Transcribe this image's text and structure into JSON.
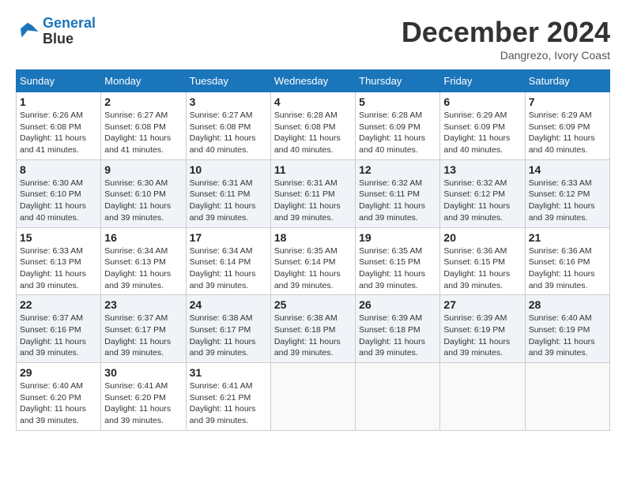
{
  "header": {
    "logo_line1": "General",
    "logo_line2": "Blue",
    "month": "December 2024",
    "location": "Dangrezo, Ivory Coast"
  },
  "days_of_week": [
    "Sunday",
    "Monday",
    "Tuesday",
    "Wednesday",
    "Thursday",
    "Friday",
    "Saturday"
  ],
  "weeks": [
    [
      {
        "day": "1",
        "sunrise": "6:26 AM",
        "sunset": "6:08 PM",
        "daylight": "11 hours and 41 minutes."
      },
      {
        "day": "2",
        "sunrise": "6:27 AM",
        "sunset": "6:08 PM",
        "daylight": "11 hours and 41 minutes."
      },
      {
        "day": "3",
        "sunrise": "6:27 AM",
        "sunset": "6:08 PM",
        "daylight": "11 hours and 40 minutes."
      },
      {
        "day": "4",
        "sunrise": "6:28 AM",
        "sunset": "6:08 PM",
        "daylight": "11 hours and 40 minutes."
      },
      {
        "day": "5",
        "sunrise": "6:28 AM",
        "sunset": "6:09 PM",
        "daylight": "11 hours and 40 minutes."
      },
      {
        "day": "6",
        "sunrise": "6:29 AM",
        "sunset": "6:09 PM",
        "daylight": "11 hours and 40 minutes."
      },
      {
        "day": "7",
        "sunrise": "6:29 AM",
        "sunset": "6:09 PM",
        "daylight": "11 hours and 40 minutes."
      }
    ],
    [
      {
        "day": "8",
        "sunrise": "6:30 AM",
        "sunset": "6:10 PM",
        "daylight": "11 hours and 40 minutes."
      },
      {
        "day": "9",
        "sunrise": "6:30 AM",
        "sunset": "6:10 PM",
        "daylight": "11 hours and 39 minutes."
      },
      {
        "day": "10",
        "sunrise": "6:31 AM",
        "sunset": "6:11 PM",
        "daylight": "11 hours and 39 minutes."
      },
      {
        "day": "11",
        "sunrise": "6:31 AM",
        "sunset": "6:11 PM",
        "daylight": "11 hours and 39 minutes."
      },
      {
        "day": "12",
        "sunrise": "6:32 AM",
        "sunset": "6:11 PM",
        "daylight": "11 hours and 39 minutes."
      },
      {
        "day": "13",
        "sunrise": "6:32 AM",
        "sunset": "6:12 PM",
        "daylight": "11 hours and 39 minutes."
      },
      {
        "day": "14",
        "sunrise": "6:33 AM",
        "sunset": "6:12 PM",
        "daylight": "11 hours and 39 minutes."
      }
    ],
    [
      {
        "day": "15",
        "sunrise": "6:33 AM",
        "sunset": "6:13 PM",
        "daylight": "11 hours and 39 minutes."
      },
      {
        "day": "16",
        "sunrise": "6:34 AM",
        "sunset": "6:13 PM",
        "daylight": "11 hours and 39 minutes."
      },
      {
        "day": "17",
        "sunrise": "6:34 AM",
        "sunset": "6:14 PM",
        "daylight": "11 hours and 39 minutes."
      },
      {
        "day": "18",
        "sunrise": "6:35 AM",
        "sunset": "6:14 PM",
        "daylight": "11 hours and 39 minutes."
      },
      {
        "day": "19",
        "sunrise": "6:35 AM",
        "sunset": "6:15 PM",
        "daylight": "11 hours and 39 minutes."
      },
      {
        "day": "20",
        "sunrise": "6:36 AM",
        "sunset": "6:15 PM",
        "daylight": "11 hours and 39 minutes."
      },
      {
        "day": "21",
        "sunrise": "6:36 AM",
        "sunset": "6:16 PM",
        "daylight": "11 hours and 39 minutes."
      }
    ],
    [
      {
        "day": "22",
        "sunrise": "6:37 AM",
        "sunset": "6:16 PM",
        "daylight": "11 hours and 39 minutes."
      },
      {
        "day": "23",
        "sunrise": "6:37 AM",
        "sunset": "6:17 PM",
        "daylight": "11 hours and 39 minutes."
      },
      {
        "day": "24",
        "sunrise": "6:38 AM",
        "sunset": "6:17 PM",
        "daylight": "11 hours and 39 minutes."
      },
      {
        "day": "25",
        "sunrise": "6:38 AM",
        "sunset": "6:18 PM",
        "daylight": "11 hours and 39 minutes."
      },
      {
        "day": "26",
        "sunrise": "6:39 AM",
        "sunset": "6:18 PM",
        "daylight": "11 hours and 39 minutes."
      },
      {
        "day": "27",
        "sunrise": "6:39 AM",
        "sunset": "6:19 PM",
        "daylight": "11 hours and 39 minutes."
      },
      {
        "day": "28",
        "sunrise": "6:40 AM",
        "sunset": "6:19 PM",
        "daylight": "11 hours and 39 minutes."
      }
    ],
    [
      {
        "day": "29",
        "sunrise": "6:40 AM",
        "sunset": "6:20 PM",
        "daylight": "11 hours and 39 minutes."
      },
      {
        "day": "30",
        "sunrise": "6:41 AM",
        "sunset": "6:20 PM",
        "daylight": "11 hours and 39 minutes."
      },
      {
        "day": "31",
        "sunrise": "6:41 AM",
        "sunset": "6:21 PM",
        "daylight": "11 hours and 39 minutes."
      },
      null,
      null,
      null,
      null
    ]
  ]
}
